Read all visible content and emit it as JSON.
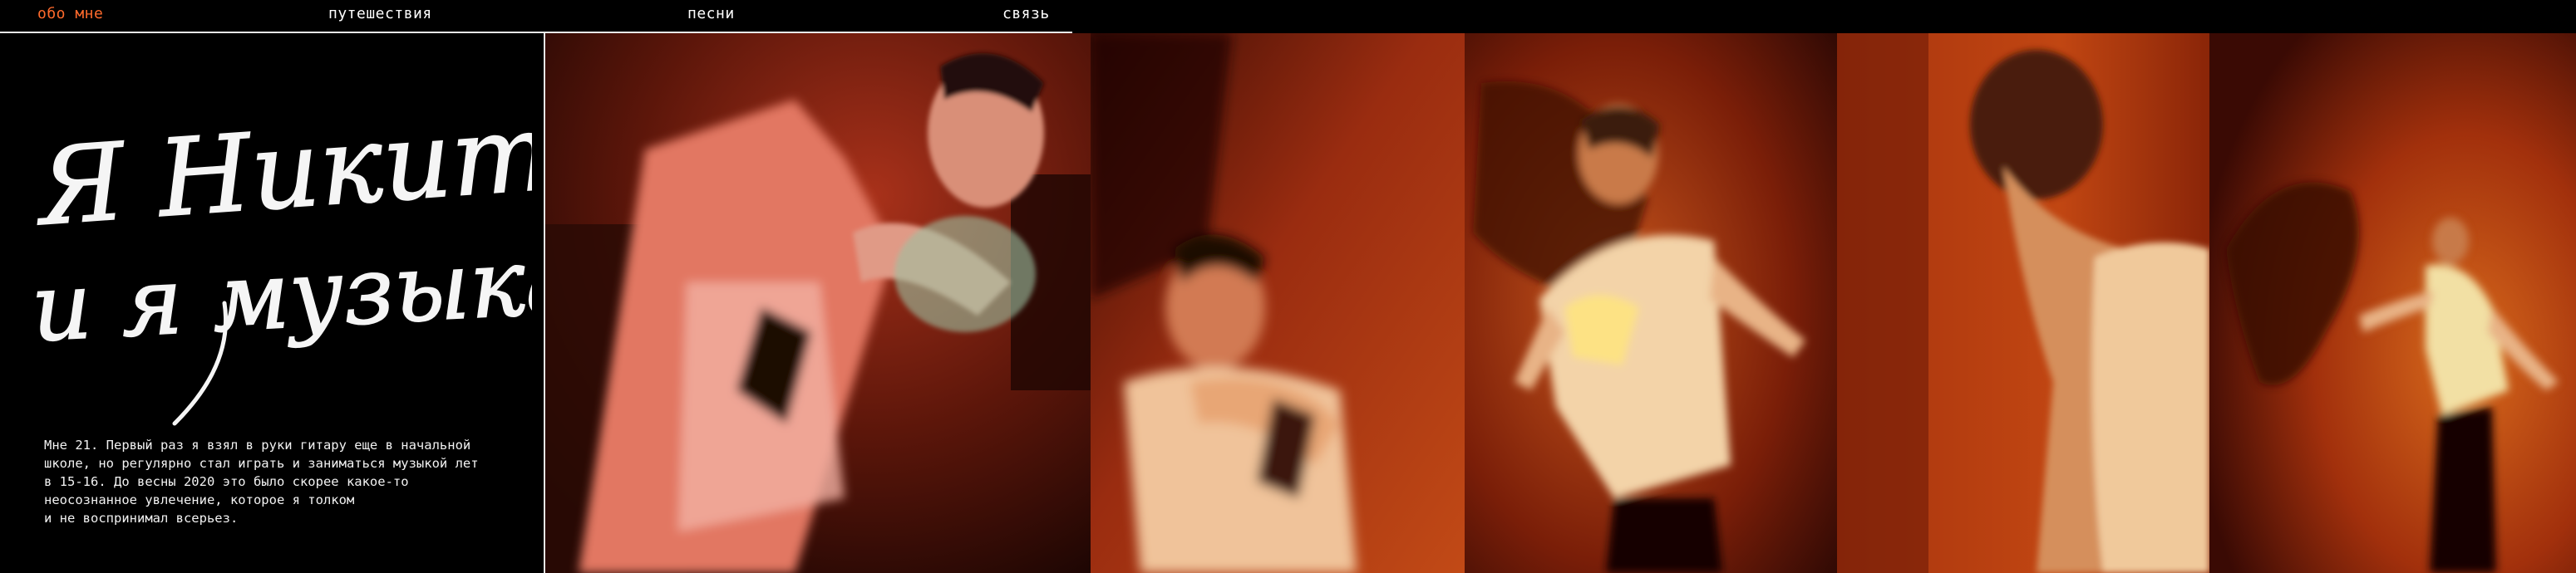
{
  "nav": {
    "items": [
      {
        "label": "обо мне",
        "active": true
      },
      {
        "label": "путешествия",
        "active": false
      },
      {
        "label": "песни",
        "active": false
      },
      {
        "label": "связь",
        "active": false
      }
    ]
  },
  "intro": {
    "headline_line1": "Я Никита",
    "headline_line2": "и я музыкант",
    "paragraph_lines": [
      "Мне 21. Первый раз я взял в руки гитару еще в начальной",
      "школе, но регулярно стал играть и заниматься музыкой лет",
      "в 15-16. До весны 2020 это было скорее какое-то",
      "неосознанное увлечение, которое я толком",
      "и не воспринимал всерьез."
    ]
  },
  "colors": {
    "accent": "#ff6a2c",
    "background": "#000000",
    "text": "#ffffff",
    "photo_dark_red": "#5a1206",
    "photo_orange": "#c8420f"
  }
}
